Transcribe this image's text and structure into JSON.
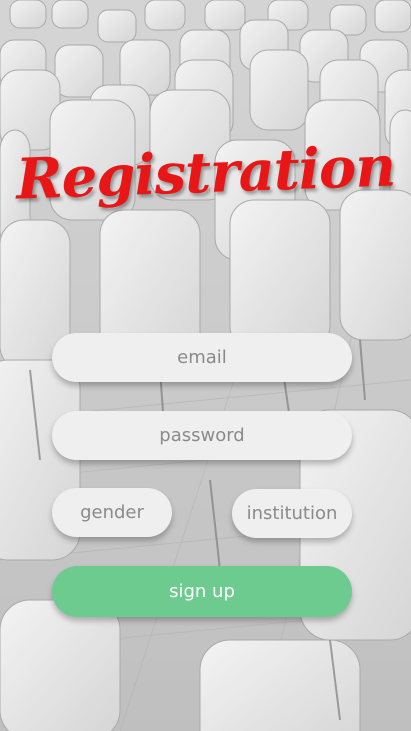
{
  "page": {
    "title": "Registration"
  },
  "form": {
    "email_placeholder": "email",
    "password_placeholder": "password",
    "gender_placeholder": "gender",
    "institution_placeholder": "institution",
    "signup_label": "sign up"
  },
  "colors": {
    "title": "#e81616",
    "signup_button": "#6dcb8f",
    "field_background": "#efefef",
    "placeholder_text": "#8a8a8a"
  }
}
